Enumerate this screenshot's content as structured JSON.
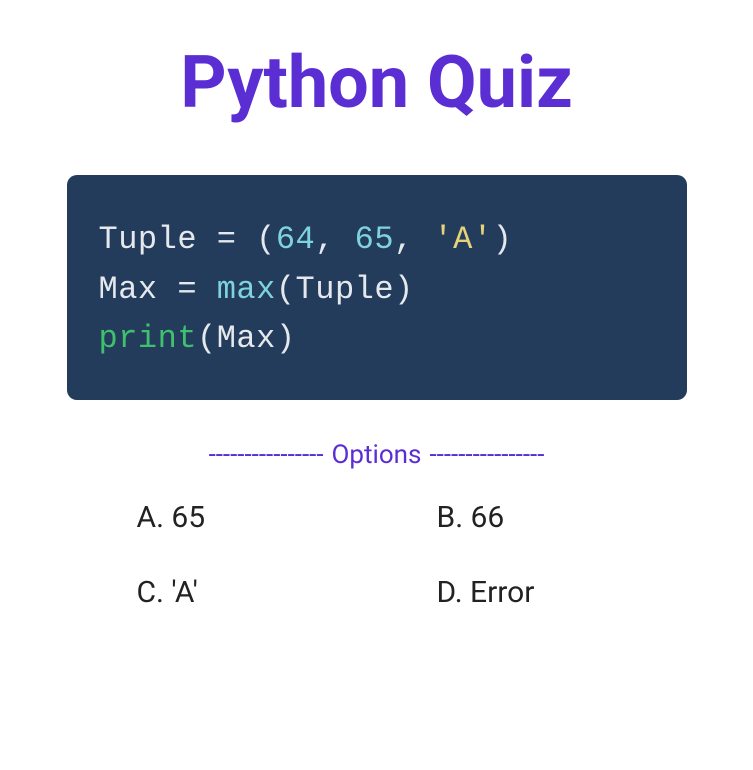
{
  "title": "Python Quiz",
  "code": {
    "line1": {
      "var": "Tuple",
      "op": " = ",
      "lparen": "(",
      "num1": "64",
      "comma1": ", ",
      "num2": "65",
      "comma2": ", ",
      "str": "'A'",
      "rparen": ")"
    },
    "line2": {
      "var": "Max",
      "op": " = ",
      "builtin": "max",
      "lparen": "(",
      "arg": "Tuple",
      "rparen": ")"
    },
    "line3": {
      "func": "print",
      "lparen": "(",
      "arg": "Max",
      "rparen": ")"
    }
  },
  "options": {
    "dash_left": "----------------",
    "word": "Options",
    "dash_right": "----------------",
    "a": "A. 65",
    "b": "B. 66",
    "c": "C. 'A'",
    "d": "D. Error"
  }
}
